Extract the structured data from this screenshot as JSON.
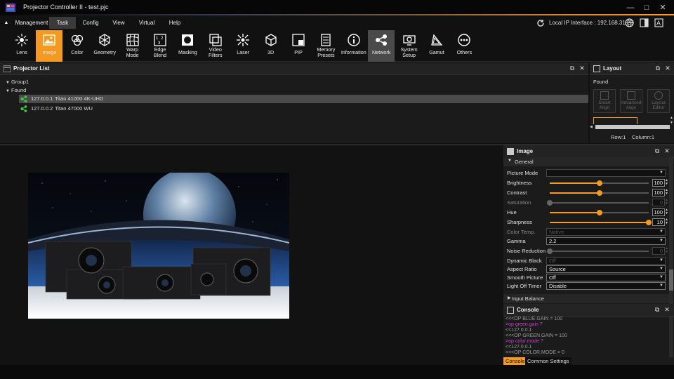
{
  "app": {
    "title": "Projector Controller II - test.pjc"
  },
  "menu": {
    "items": [
      "Management",
      "Task",
      "Config",
      "View",
      "Virtual",
      "Help"
    ],
    "active": "Task",
    "ip_label": "Local IP Interface : 192.168.31.23"
  },
  "toolbar": {
    "items": [
      {
        "label": "Lens",
        "icon": "lens-icon"
      },
      {
        "label": "Image",
        "icon": "image-icon"
      },
      {
        "label": "Color",
        "icon": "color-icon"
      },
      {
        "label": "Geometry",
        "icon": "geometry-icon"
      },
      {
        "label": "Warp\nMode",
        "icon": "warp-icon"
      },
      {
        "label": "Edge\nBlend",
        "icon": "edge-blend-icon"
      },
      {
        "label": "Masking",
        "icon": "masking-icon"
      },
      {
        "label": "Video\nFilters",
        "icon": "video-filters-icon"
      },
      {
        "label": "Laser",
        "icon": "laser-icon"
      },
      {
        "label": "3D",
        "icon": "3d-icon"
      },
      {
        "label": "PIP",
        "icon": "pip-icon"
      },
      {
        "label": "Memory\nPresets",
        "icon": "memory-icon"
      },
      {
        "label": "Information",
        "icon": "info-icon"
      },
      {
        "label": "Network",
        "icon": "network-icon"
      },
      {
        "label": "System\nSetup",
        "icon": "system-icon"
      },
      {
        "label": "Gamut",
        "icon": "gamut-icon"
      },
      {
        "label": "Others",
        "icon": "others-icon"
      }
    ],
    "active": "Image",
    "selected": "Network"
  },
  "projector_list": {
    "title": "Projector List",
    "group": "Group1",
    "found": "Found",
    "devices": [
      {
        "ip": "127.0.0.1",
        "model": "Titan 41000 4K-UHD"
      },
      {
        "ip": "127.0.0.2",
        "model": "Titan 47000 WU"
      }
    ]
  },
  "layout": {
    "title": "Layout",
    "found": "Found",
    "smart_align": "Smart\nAlign",
    "advanced_align": "Advanced\nAlign",
    "layout_editor": "Layout\nEditor",
    "row": "Row:1",
    "column": "Column:1"
  },
  "image_panel": {
    "title": "Image",
    "section": "General",
    "input_balance": "Input Balance",
    "picture_mode": {
      "label": "Picture Mode",
      "value": ""
    },
    "brightness": {
      "label": "Brightness",
      "value": "100",
      "level": 0.5
    },
    "contrast": {
      "label": "Contrast",
      "value": "100",
      "level": 0.5
    },
    "saturation": {
      "label": "Saturation",
      "value": "0",
      "level": 0.0
    },
    "hue": {
      "label": "Hue",
      "value": "100",
      "level": 0.5
    },
    "sharpness": {
      "label": "Sharpness",
      "value": "10",
      "level": 1.0
    },
    "color_temp": {
      "label": "Color Temp.",
      "value": "Native"
    },
    "gamma": {
      "label": "Gamma",
      "value": "2.2"
    },
    "noise_reduction": {
      "label": "Noise Reduction",
      "value": "0",
      "level": 0.0
    },
    "dynamic_black": {
      "label": "Dynamic Black",
      "value": "Off"
    },
    "aspect_ratio": {
      "label": "Aspect Ratio",
      "value": "Source"
    },
    "smooth_picture": {
      "label": "Smooth Picture",
      "value": "Off"
    },
    "light_off_timer": {
      "label": "Light Off Timer",
      "value": "Disable"
    }
  },
  "console": {
    "title": "Console",
    "lines": [
      {
        "text": "<<<OP BLUE.GAIN = 100",
        "kind": "resp"
      },
      {
        "text": ">op green.gain ?",
        "kind": "cmd"
      },
      {
        "text": "<<127.0.0.1",
        "kind": "resp"
      },
      {
        "text": "<<<OP GREEN.GAIN = 100",
        "kind": "resp"
      },
      {
        "text": ">op color.mode ?",
        "kind": "cmd"
      },
      {
        "text": "<<127.0.0.1",
        "kind": "resp"
      },
      {
        "text": "<<<OP COLOR.MODE = 0",
        "kind": "resp"
      }
    ],
    "tabs": [
      "Console",
      "Common Settings"
    ],
    "active_tab": "Console"
  },
  "colors": {
    "accent": "#f49a20",
    "cmd": "#d13ad6",
    "device_icon": "#3ecf3e"
  }
}
